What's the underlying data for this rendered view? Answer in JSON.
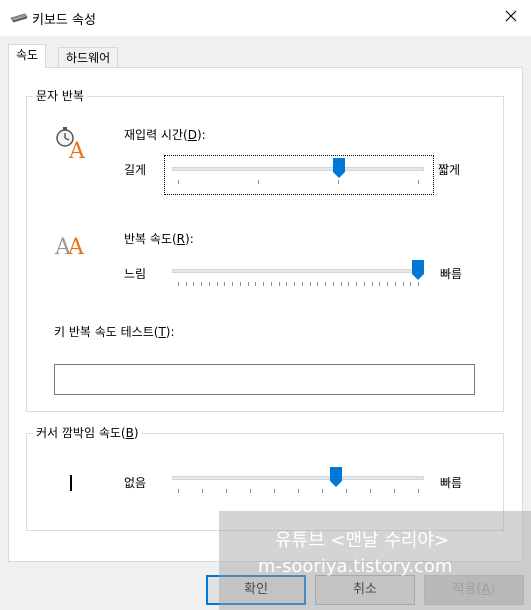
{
  "window": {
    "title": "키보드 속성"
  },
  "tabs": [
    {
      "label": "속도",
      "active": true
    },
    {
      "label": "하드웨어",
      "active": false
    }
  ],
  "char_repeat": {
    "group_title": "문자 반복",
    "delay": {
      "label_text": "재입력 시간(",
      "label_key": "D",
      "label_end": "):",
      "left": "길게",
      "right": "짧게",
      "value": 0.67
    },
    "rate": {
      "label_text": "반복 속도(",
      "label_key": "R",
      "label_end": "):",
      "left": "느림",
      "right": "빠름",
      "value": 1.0
    },
    "test": {
      "label_text": "키 반복 속도 테스트(",
      "label_key": "T",
      "label_end": "):",
      "value": ""
    }
  },
  "cursor_blink": {
    "group_title_text": "커서 깜박임 속도(",
    "group_title_key": "B",
    "group_title_end": ")",
    "left": "없음",
    "right": "빠름",
    "value": 0.66
  },
  "buttons": {
    "ok": "확인",
    "cancel": "취소",
    "apply_text": "적용(",
    "apply_key": "A",
    "apply_end": ")"
  },
  "watermark": {
    "line1": "유튜브 <맨날 수리야>",
    "line2": "m-sooriya.tistory.com"
  },
  "colors": {
    "accent": "#0078d7",
    "icon_orange": "#e8731a"
  },
  "icons": [
    "keyboard-icon",
    "close-icon",
    "stopwatch-a-icon",
    "double-a-icon",
    "cursor-icon"
  ]
}
